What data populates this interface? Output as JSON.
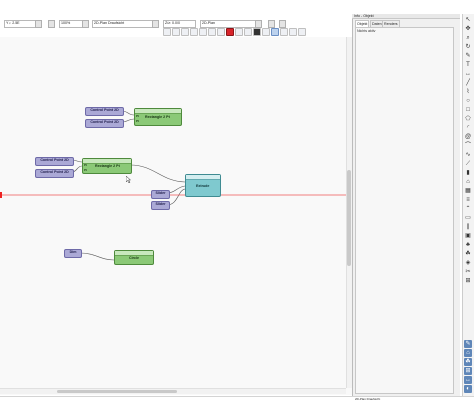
{
  "panel": {
    "title": "Info - Objekt",
    "tabs": [
      {
        "label": "Objekt"
      },
      {
        "label": "Daten"
      },
      {
        "label": "Renders"
      }
    ],
    "empty_text": "Nichts aktiv"
  },
  "toolbar": {
    "field_x": "Y↓: 2.5E",
    "field_percent": "100%",
    "field_view": "2D-Plan Draufsicht",
    "field_z": "Z/z: 0.0/0",
    "field_plan": "2D-Plan"
  },
  "nodes": {
    "cp1": "Control Point 2D",
    "cp2": "Control Point 2D",
    "cp3": "Control Point 2D",
    "cp4": "Control Point 2D",
    "rect1": "Rectangle 2 Pt",
    "rect2": "Rectangle 2 Pt",
    "extrude": "Extrude",
    "slider1": "Slider",
    "slider2": "Slider",
    "dim": "Dim",
    "circle": "Circle"
  },
  "status": {
    "right_text": "2D-Plan Draufsicht"
  },
  "colors": {
    "point_node": "#aba9d6",
    "shape_node": "#8bc977",
    "extrude_node": "#7fc9cf",
    "selected_tool": "#5f86b8"
  }
}
